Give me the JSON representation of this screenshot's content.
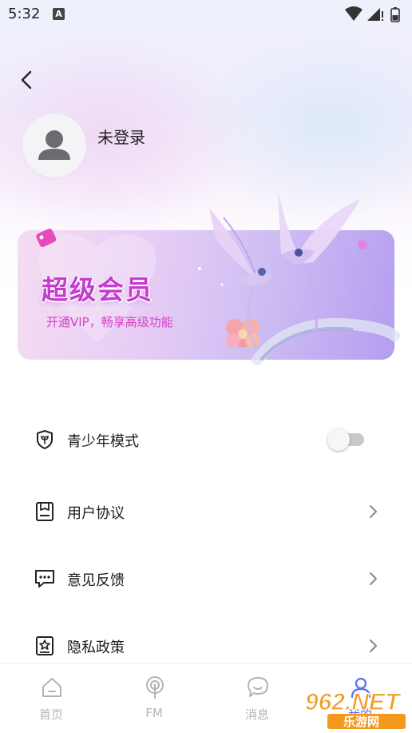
{
  "status_bar": {
    "time": "5:32",
    "notification_icon": "a-icon"
  },
  "header": {
    "back_icon": "chevron-left-icon"
  },
  "profile": {
    "name": "未登录",
    "avatar_icon": "user-icon"
  },
  "vip_banner": {
    "title": "超级会员",
    "subtitle": "开通VIP，畅享高级功能"
  },
  "menu": {
    "items": [
      {
        "label": "青少年模式",
        "icon": "shield-sprout-icon",
        "control": "toggle",
        "toggle_on": false
      },
      {
        "label": "用户协议",
        "icon": "document-icon",
        "control": "chevron"
      },
      {
        "label": "意见反馈",
        "icon": "feedback-icon",
        "control": "chevron"
      },
      {
        "label": "隐私政策",
        "icon": "privacy-star-icon",
        "control": "chevron"
      }
    ]
  },
  "bottom_nav": {
    "items": [
      {
        "label": "首页",
        "icon": "home-icon",
        "active": false
      },
      {
        "label": "FM",
        "icon": "radio-icon",
        "active": false
      },
      {
        "label": "消息",
        "icon": "chat-icon",
        "active": false
      },
      {
        "label": "我的",
        "icon": "profile-icon",
        "active": true
      }
    ]
  },
  "watermark": {
    "text_top": "962.NET",
    "text_bottom": "乐游网"
  },
  "colors": {
    "accent": "#5b6df0",
    "vip_title": "#c53bd0",
    "vip_subtitle": "#d93fc7",
    "nav_inactive": "#b4b4b8"
  }
}
